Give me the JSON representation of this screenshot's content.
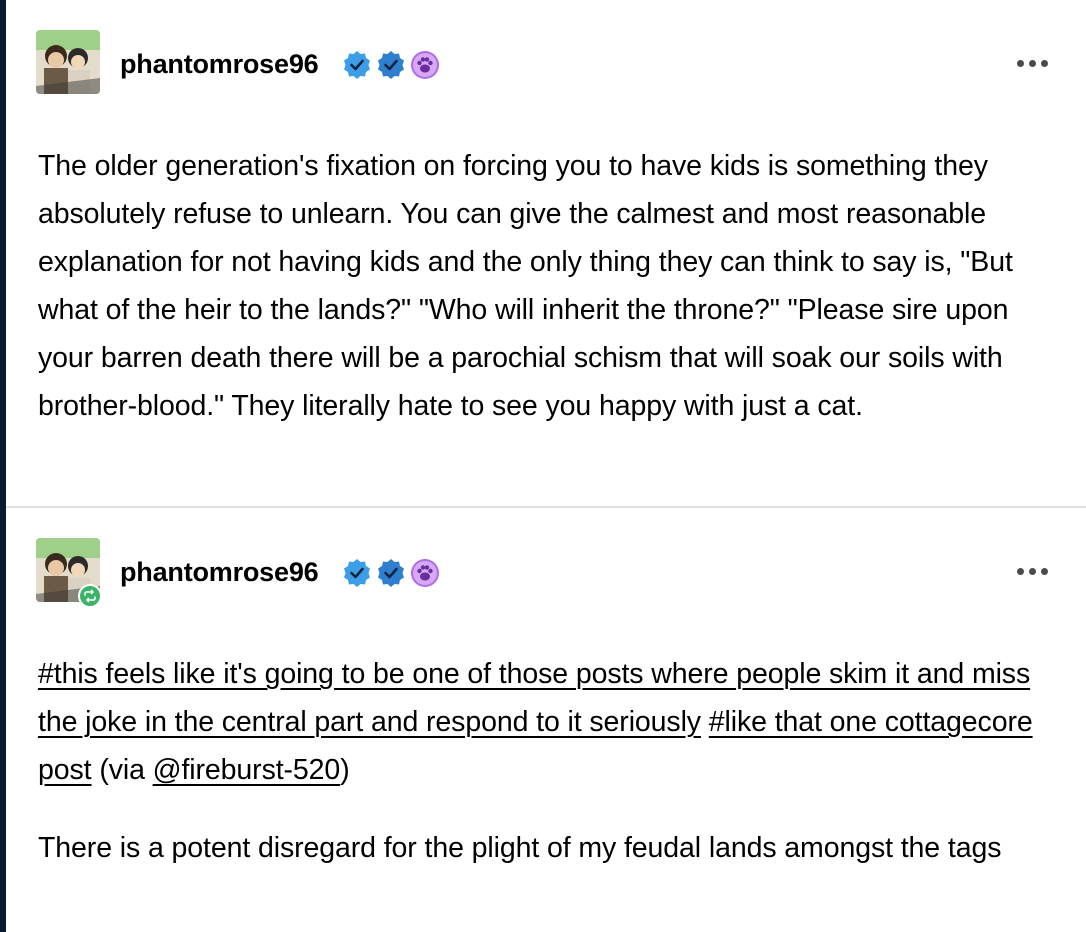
{
  "posts": [
    {
      "username": "phantomrose96",
      "avatar": "avatar-image",
      "badges": [
        "verified-check-icon",
        "verified-check-icon",
        "paw-badge-icon"
      ],
      "body": "The older generation's fixation on forcing you to have kids is something they absolutely refuse to unlearn. You can give the calmest and most reasonable explanation for not having kids and the only thing they can think to say is, \"But what of the heir to the lands?\" \"Who will inherit the throne?\" \"Please sire upon your barren death there will be a parochial schism that will soak our soils with brother-blood.\" They literally hate to see you happy with just a cat."
    },
    {
      "username": "phantomrose96",
      "avatar": "avatar-image",
      "reblog_icon": "reblog-icon",
      "badges": [
        "verified-check-icon",
        "verified-check-icon",
        "paw-badge-icon"
      ],
      "tags": [
        "#this feels like it's going to be one of those posts where people skim it and miss the joke in the central part and respond to it seriously",
        "#like that one cottagecore post"
      ],
      "via_prefix": "(via ",
      "via_user": "@fireburst-520",
      "via_suffix": ")",
      "reply": "There is a potent disregard for the plight of my feudal lands amongst the tags"
    }
  ],
  "colors": {
    "verified_blue": "#3d9ee8",
    "verified_blue_dark": "#2f7fd1",
    "paw_purple": "#b06be6",
    "reblog_green": "#3bb36b",
    "divider": "#e3e3e3",
    "page_edge": "#0b1a33"
  }
}
